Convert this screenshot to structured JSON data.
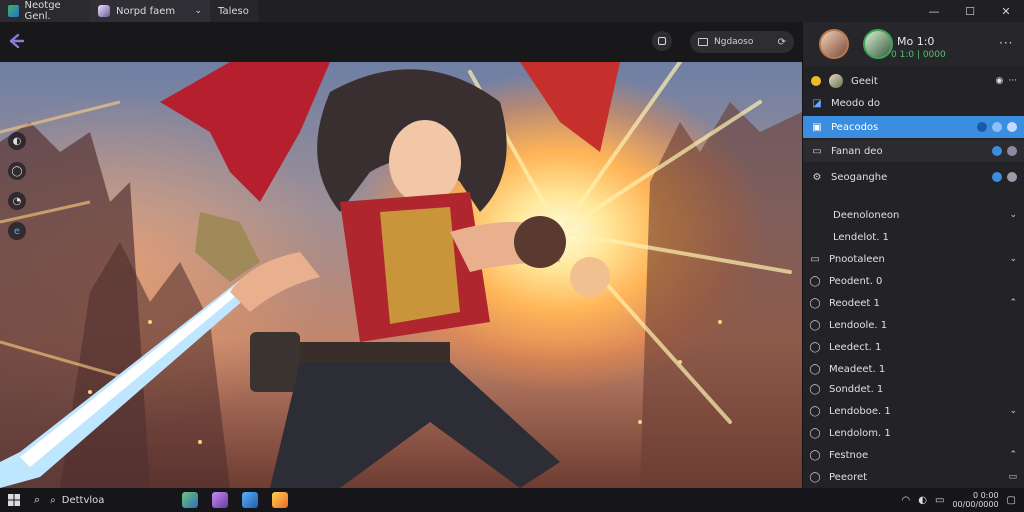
{
  "tabs": [
    {
      "label": "Neotge Genl."
    },
    {
      "label": "Norpd faem"
    },
    {
      "label": "Taleso"
    }
  ],
  "window_controls": {
    "minimize": "—",
    "maximize": "☐",
    "close": "✕"
  },
  "toolbar": {
    "search_label": "Ngdaoso"
  },
  "panel": {
    "user_name": "Mo 1:0",
    "user_status": "0 1:0 | 0000",
    "rows": [
      {
        "label": "Geeit"
      },
      {
        "label": "Meodo do"
      },
      {
        "label": "Peacodos"
      },
      {
        "label": "Fanan deo"
      },
      {
        "label": "Seoganghe"
      },
      {
        "label": "Deenoloneon"
      },
      {
        "label": "Lendelot. 1"
      },
      {
        "label": "Pnootaleen"
      },
      {
        "label": "Peodent. 0"
      },
      {
        "label": "Reodeet 1"
      },
      {
        "label": "Lendoole. 1"
      },
      {
        "label": "Leedect. 1"
      },
      {
        "label": "Meadeet. 1"
      },
      {
        "label": "Sonddet. 1"
      },
      {
        "label": "Lendoboe. 1"
      },
      {
        "label": "Lendolom. 1"
      },
      {
        "label": "Festnoe"
      },
      {
        "label": "Peeoret"
      }
    ]
  },
  "taskbar": {
    "search_label": "Dettvloa",
    "time": "0 0:00",
    "date": "00/00/0000"
  },
  "colors": {
    "accent": "#3b8ddf",
    "online": "#51c46a",
    "back_arrow": "#8f7bd6"
  }
}
